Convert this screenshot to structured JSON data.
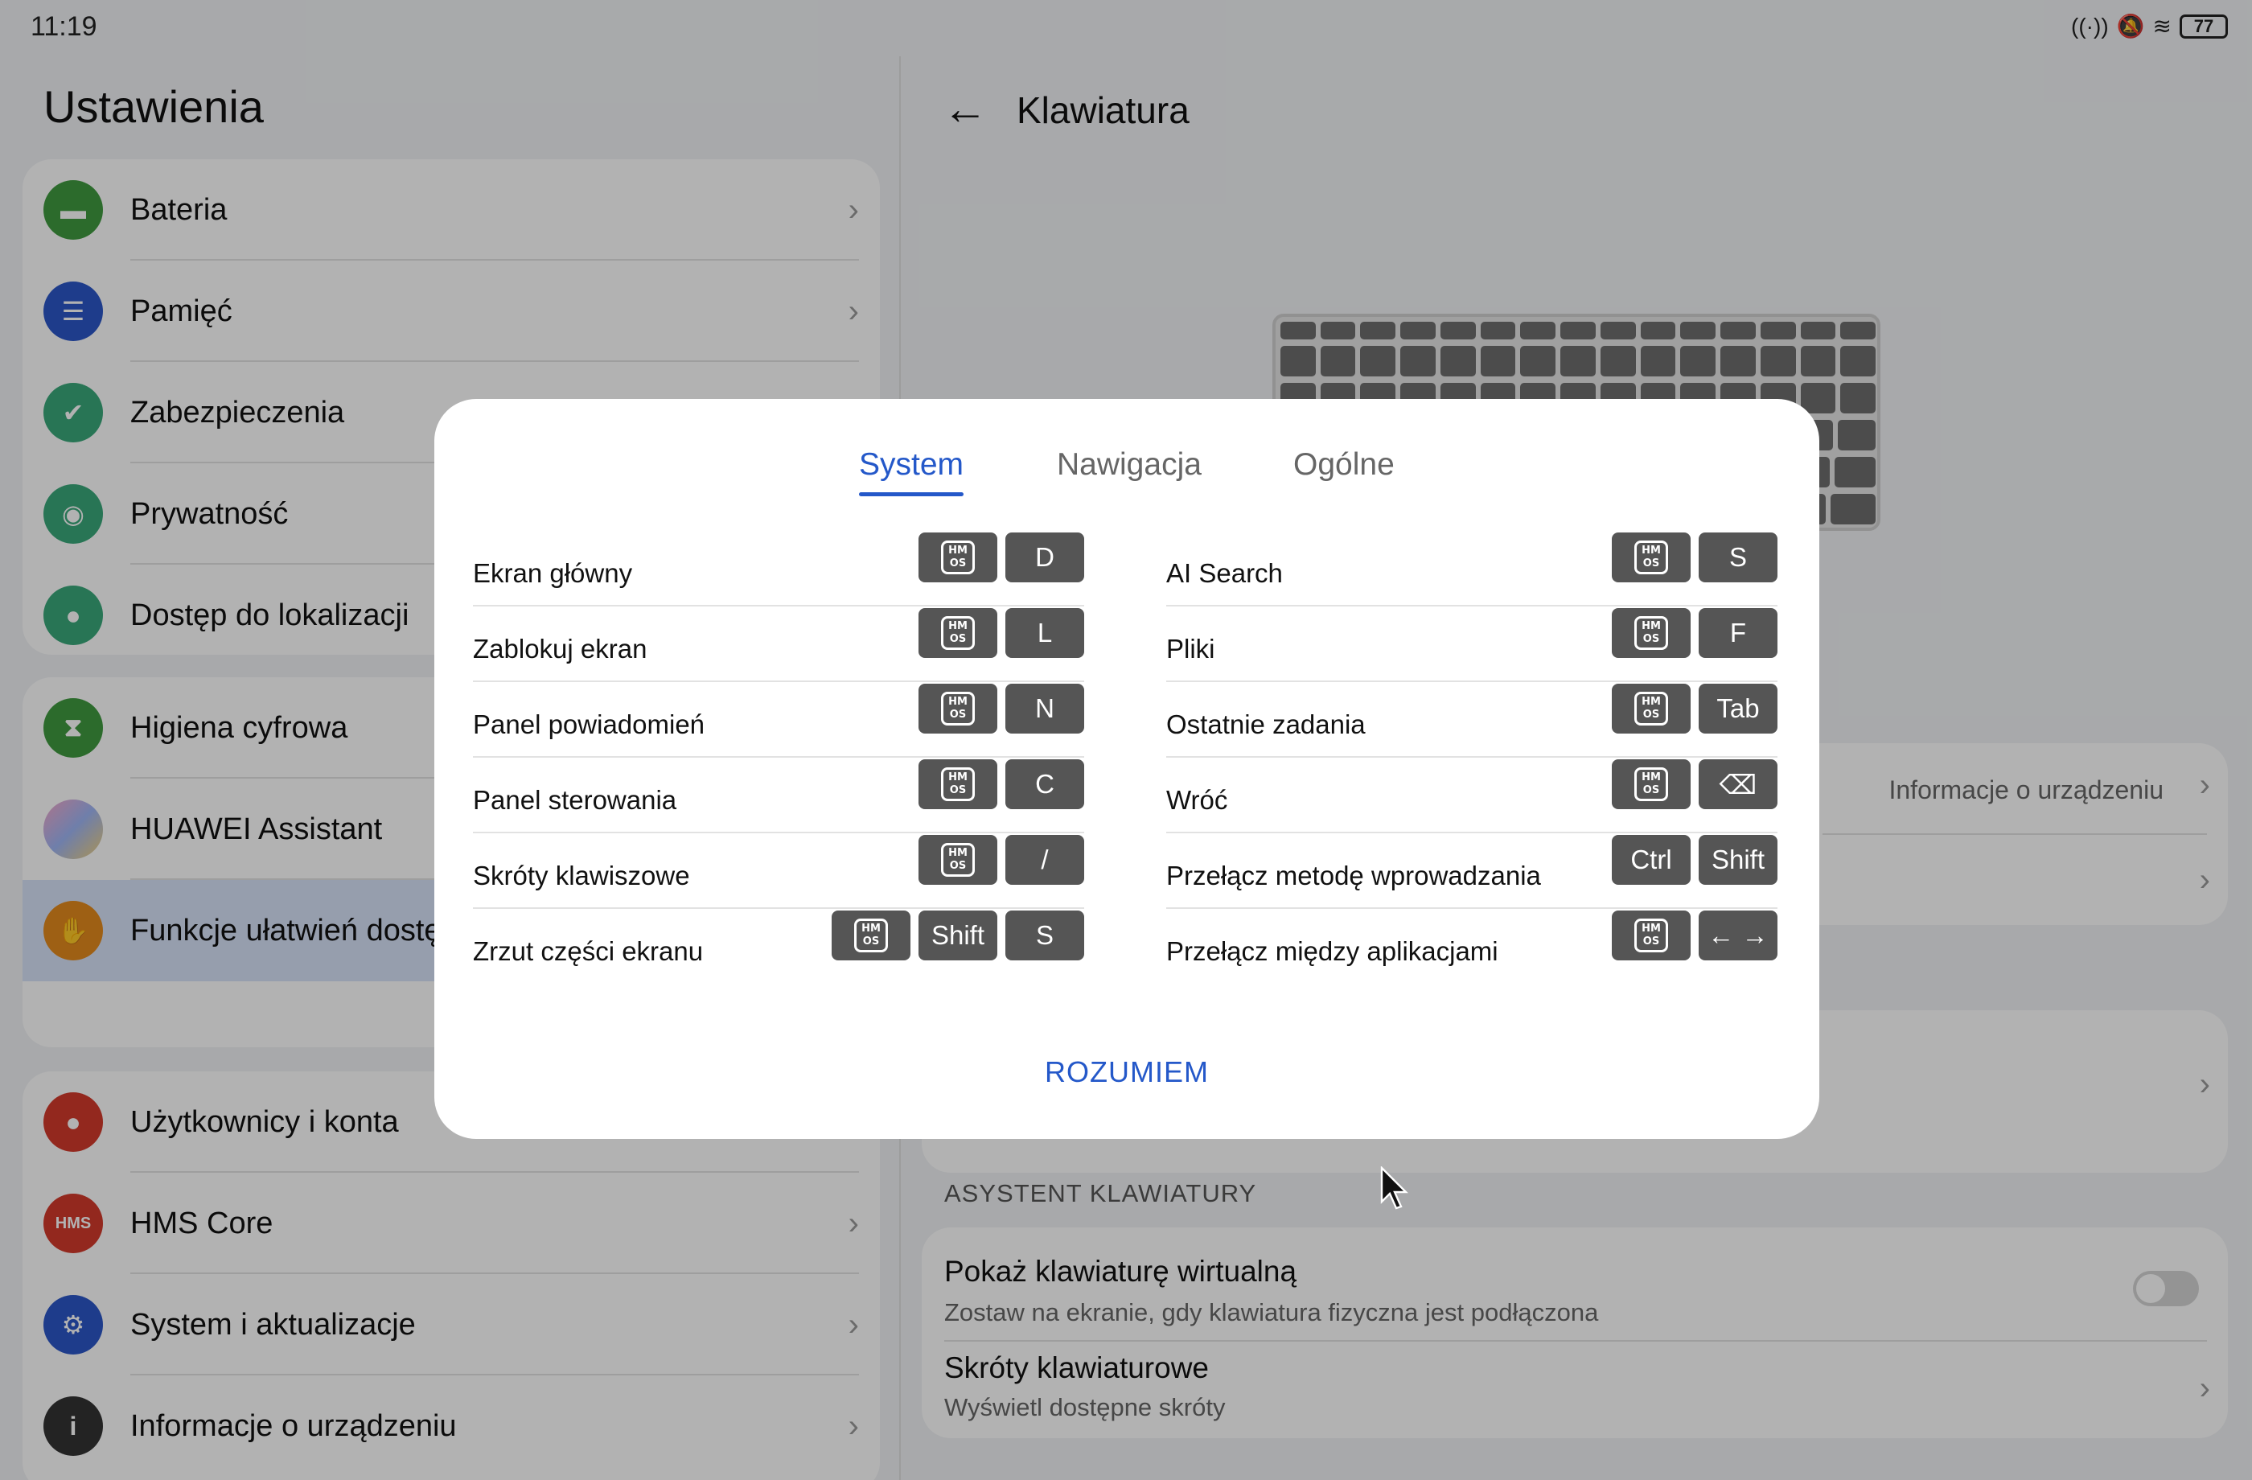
{
  "status": {
    "time": "11:19",
    "battery": "77"
  },
  "left": {
    "title": "Ustawienia",
    "groups": [
      {
        "items": [
          {
            "label": "Bateria",
            "color": "#3f9a3f",
            "icon": "battery-icon"
          },
          {
            "label": "Pamięć",
            "color": "#2b57c8",
            "icon": "storage-icon"
          },
          {
            "label": "Zabezpieczenia",
            "color": "#3aa87a",
            "icon": "shield-icon"
          },
          {
            "label": "Prywatność",
            "color": "#3aa87a",
            "icon": "privacy-icon"
          },
          {
            "label": "Dostęp do lokalizacji",
            "color": "#3aa87a",
            "icon": "location-icon"
          }
        ]
      },
      {
        "items": [
          {
            "label": "Higiena cyfrowa",
            "color": "#3f9a3f",
            "icon": "hourglass-icon"
          },
          {
            "label": "HUAWEI Assistant",
            "color": "#c58be0",
            "icon": "assistant-icon"
          },
          {
            "label": "Funkcje ułatwień dostę",
            "color": "#e38a1e",
            "icon": "hand-icon"
          }
        ]
      },
      {
        "items": [
          {
            "label": "Użytkownicy i konta",
            "color": "#d33a2c",
            "icon": "user-icon"
          },
          {
            "label": "HMS Core",
            "color": "#d33a2c",
            "icon": "hms-icon",
            "text": "HMS"
          },
          {
            "label": "System i aktualizacje",
            "color": "#2b57c8",
            "icon": "gear-icon"
          },
          {
            "label": "Informacje o urządzeniu",
            "color": "#333333",
            "icon": "info-icon"
          }
        ]
      }
    ]
  },
  "right": {
    "title": "Klawiatura",
    "card1_value": "Informacje o urządzeniu",
    "section": "ASYSTENT KLAWIATURY",
    "virtual_title": "Pokaż klawiaturę wirtualną",
    "virtual_sub": "Zostaw na ekranie, gdy klawiatura fizyczna jest podłączona",
    "shortcuts_title": "Skróty klawiaturowe",
    "shortcuts_sub": "Wyświetl dostępne skróty"
  },
  "dialog": {
    "tabs": [
      "System",
      "Nawigacja",
      "Ogólne"
    ],
    "active_tab": 0,
    "left_rows": [
      {
        "label": "Ekran główny",
        "keys": [
          "HMS",
          "D"
        ]
      },
      {
        "label": "Zablokuj ekran",
        "keys": [
          "HMS",
          "L"
        ]
      },
      {
        "label": "Panel powiadomień",
        "keys": [
          "HMS",
          "N"
        ]
      },
      {
        "label": "Panel sterowania",
        "keys": [
          "HMS",
          "C"
        ]
      },
      {
        "label": "Skróty klawiszowe",
        "keys": [
          "HMS",
          "/"
        ]
      },
      {
        "label": "Zrzut części ekranu",
        "keys": [
          "HMS",
          "Shift",
          "S"
        ]
      }
    ],
    "right_rows": [
      {
        "label": "AI Search",
        "keys": [
          "HMS",
          "S"
        ]
      },
      {
        "label": "Pliki",
        "keys": [
          "HMS",
          "F"
        ]
      },
      {
        "label": "Ostatnie zadania",
        "keys": [
          "HMS",
          "Tab"
        ]
      },
      {
        "label": "Wróć",
        "keys": [
          "HMS",
          "⌫"
        ]
      },
      {
        "label": "Przełącz metodę wprowadzania",
        "keys": [
          "Ctrl",
          "Shift"
        ]
      },
      {
        "label": "Przełącz między aplikacjami",
        "keys": [
          "HMS",
          "← →"
        ]
      }
    ],
    "confirm": "ROZUMIEM"
  }
}
